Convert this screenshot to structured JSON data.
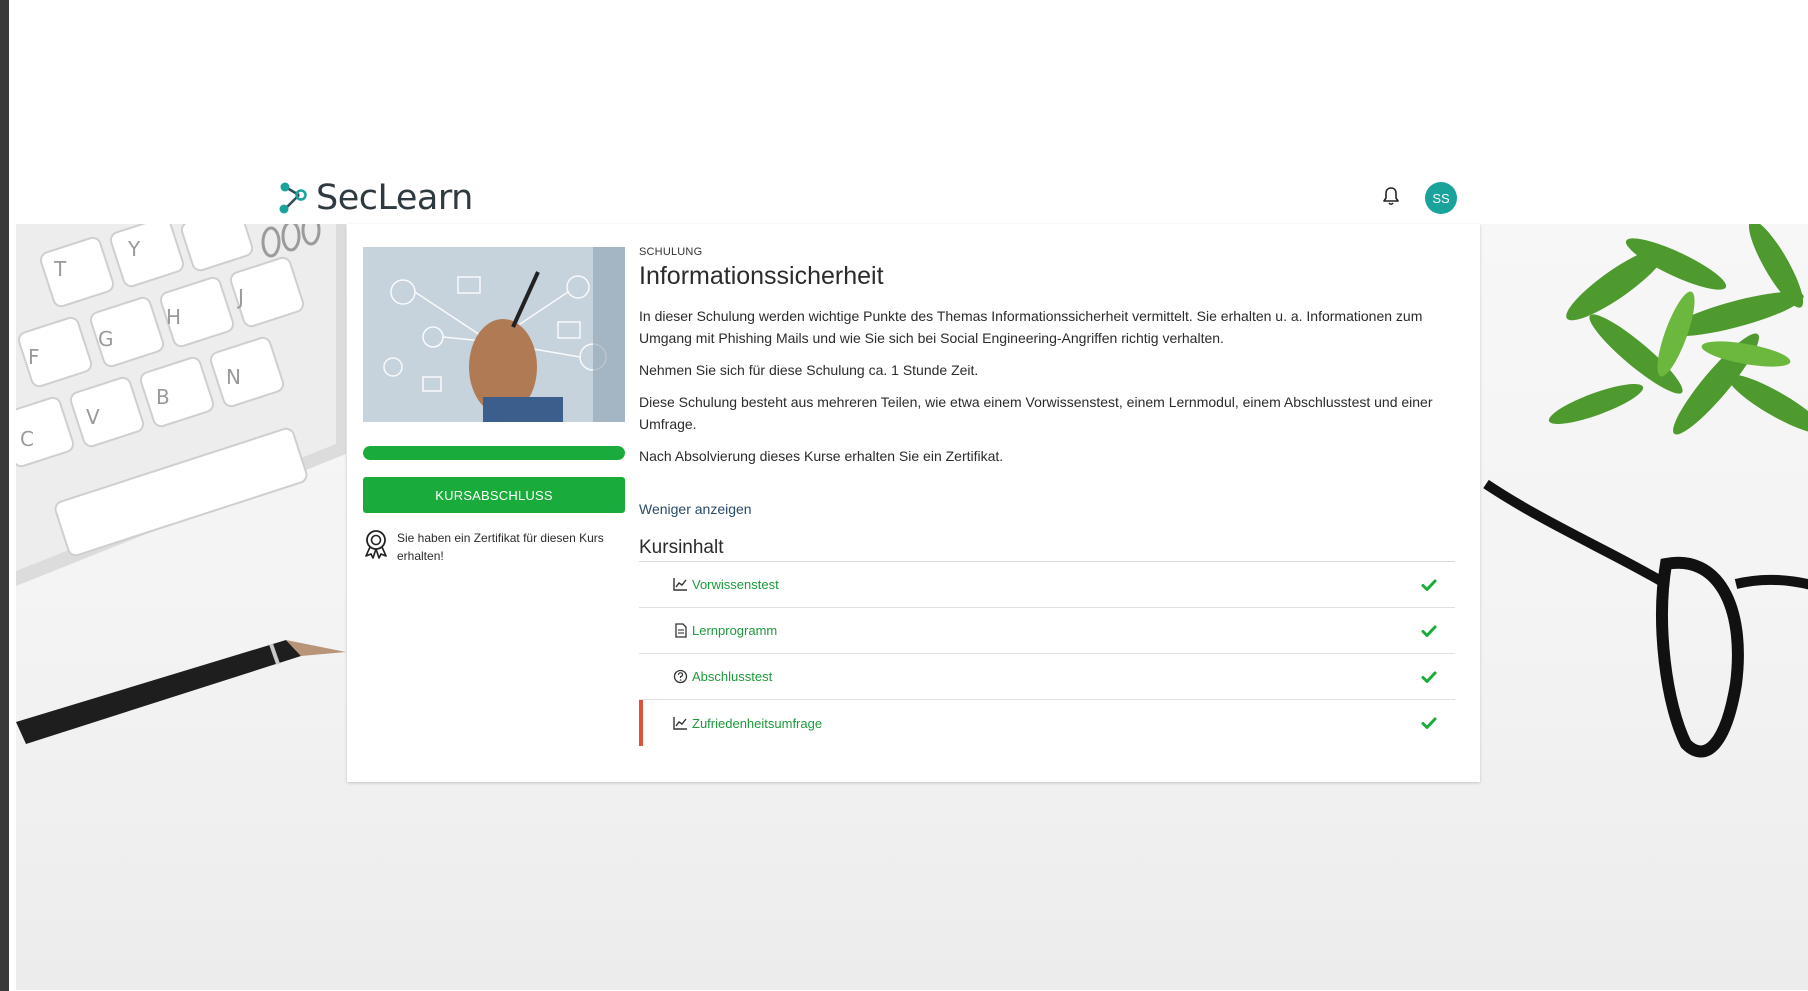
{
  "brand": {
    "name": "SecLearn",
    "accent": "#19a39a"
  },
  "header": {
    "notification_icon": "bell-icon",
    "avatar_initials": "SS",
    "avatar_color": "#19a39a"
  },
  "course": {
    "category": "SCHULUNG",
    "title": "Informationssicherheit",
    "description": [
      "In dieser Schulung werden wichtige Punkte des Themas Informationssicherheit vermittelt. Sie erhalten u. a. Informationen zum Umgang mit Phishing Mails und wie Sie sich bei Social Engineering-Angriffen richtig verhalten.",
      "Nehmen Sie sich für diese Schulung ca. 1 Stunde Zeit.",
      "Diese Schulung besteht aus mehreren Teilen, wie etwa einem Vorwissenstest, einem Lernmodul, einem Abschlusstest und einer Umfrage.",
      "Nach Absolvierung dieses Kurse erhalten Sie ein Zertifikat."
    ],
    "show_less_label": "Weniger anzeigen",
    "progress_fraction": 1.0,
    "progress_color": "#1aac3a",
    "complete_button_label": "KURSABSCHLUSS",
    "certificate_message": "Sie haben ein Zertifikat für diesen Kurs erhalten!",
    "certificate_icon": "award-icon"
  },
  "content": {
    "title": "Kursinhalt",
    "items": [
      {
        "label": "Vorwissenstest",
        "icon": "chart-line-icon",
        "completed": true,
        "active": false
      },
      {
        "label": "Lernprogramm",
        "icon": "document-icon",
        "completed": true,
        "active": false
      },
      {
        "label": "Abschlusstest",
        "icon": "question-circle-icon",
        "completed": true,
        "active": false
      },
      {
        "label": "Zufriedenheitsumfrage",
        "icon": "chart-line-icon",
        "completed": true,
        "active": true
      }
    ],
    "link_color": "#1a9a3a",
    "check_color": "#1aac3a",
    "active_marker_color": "#e0523a"
  }
}
